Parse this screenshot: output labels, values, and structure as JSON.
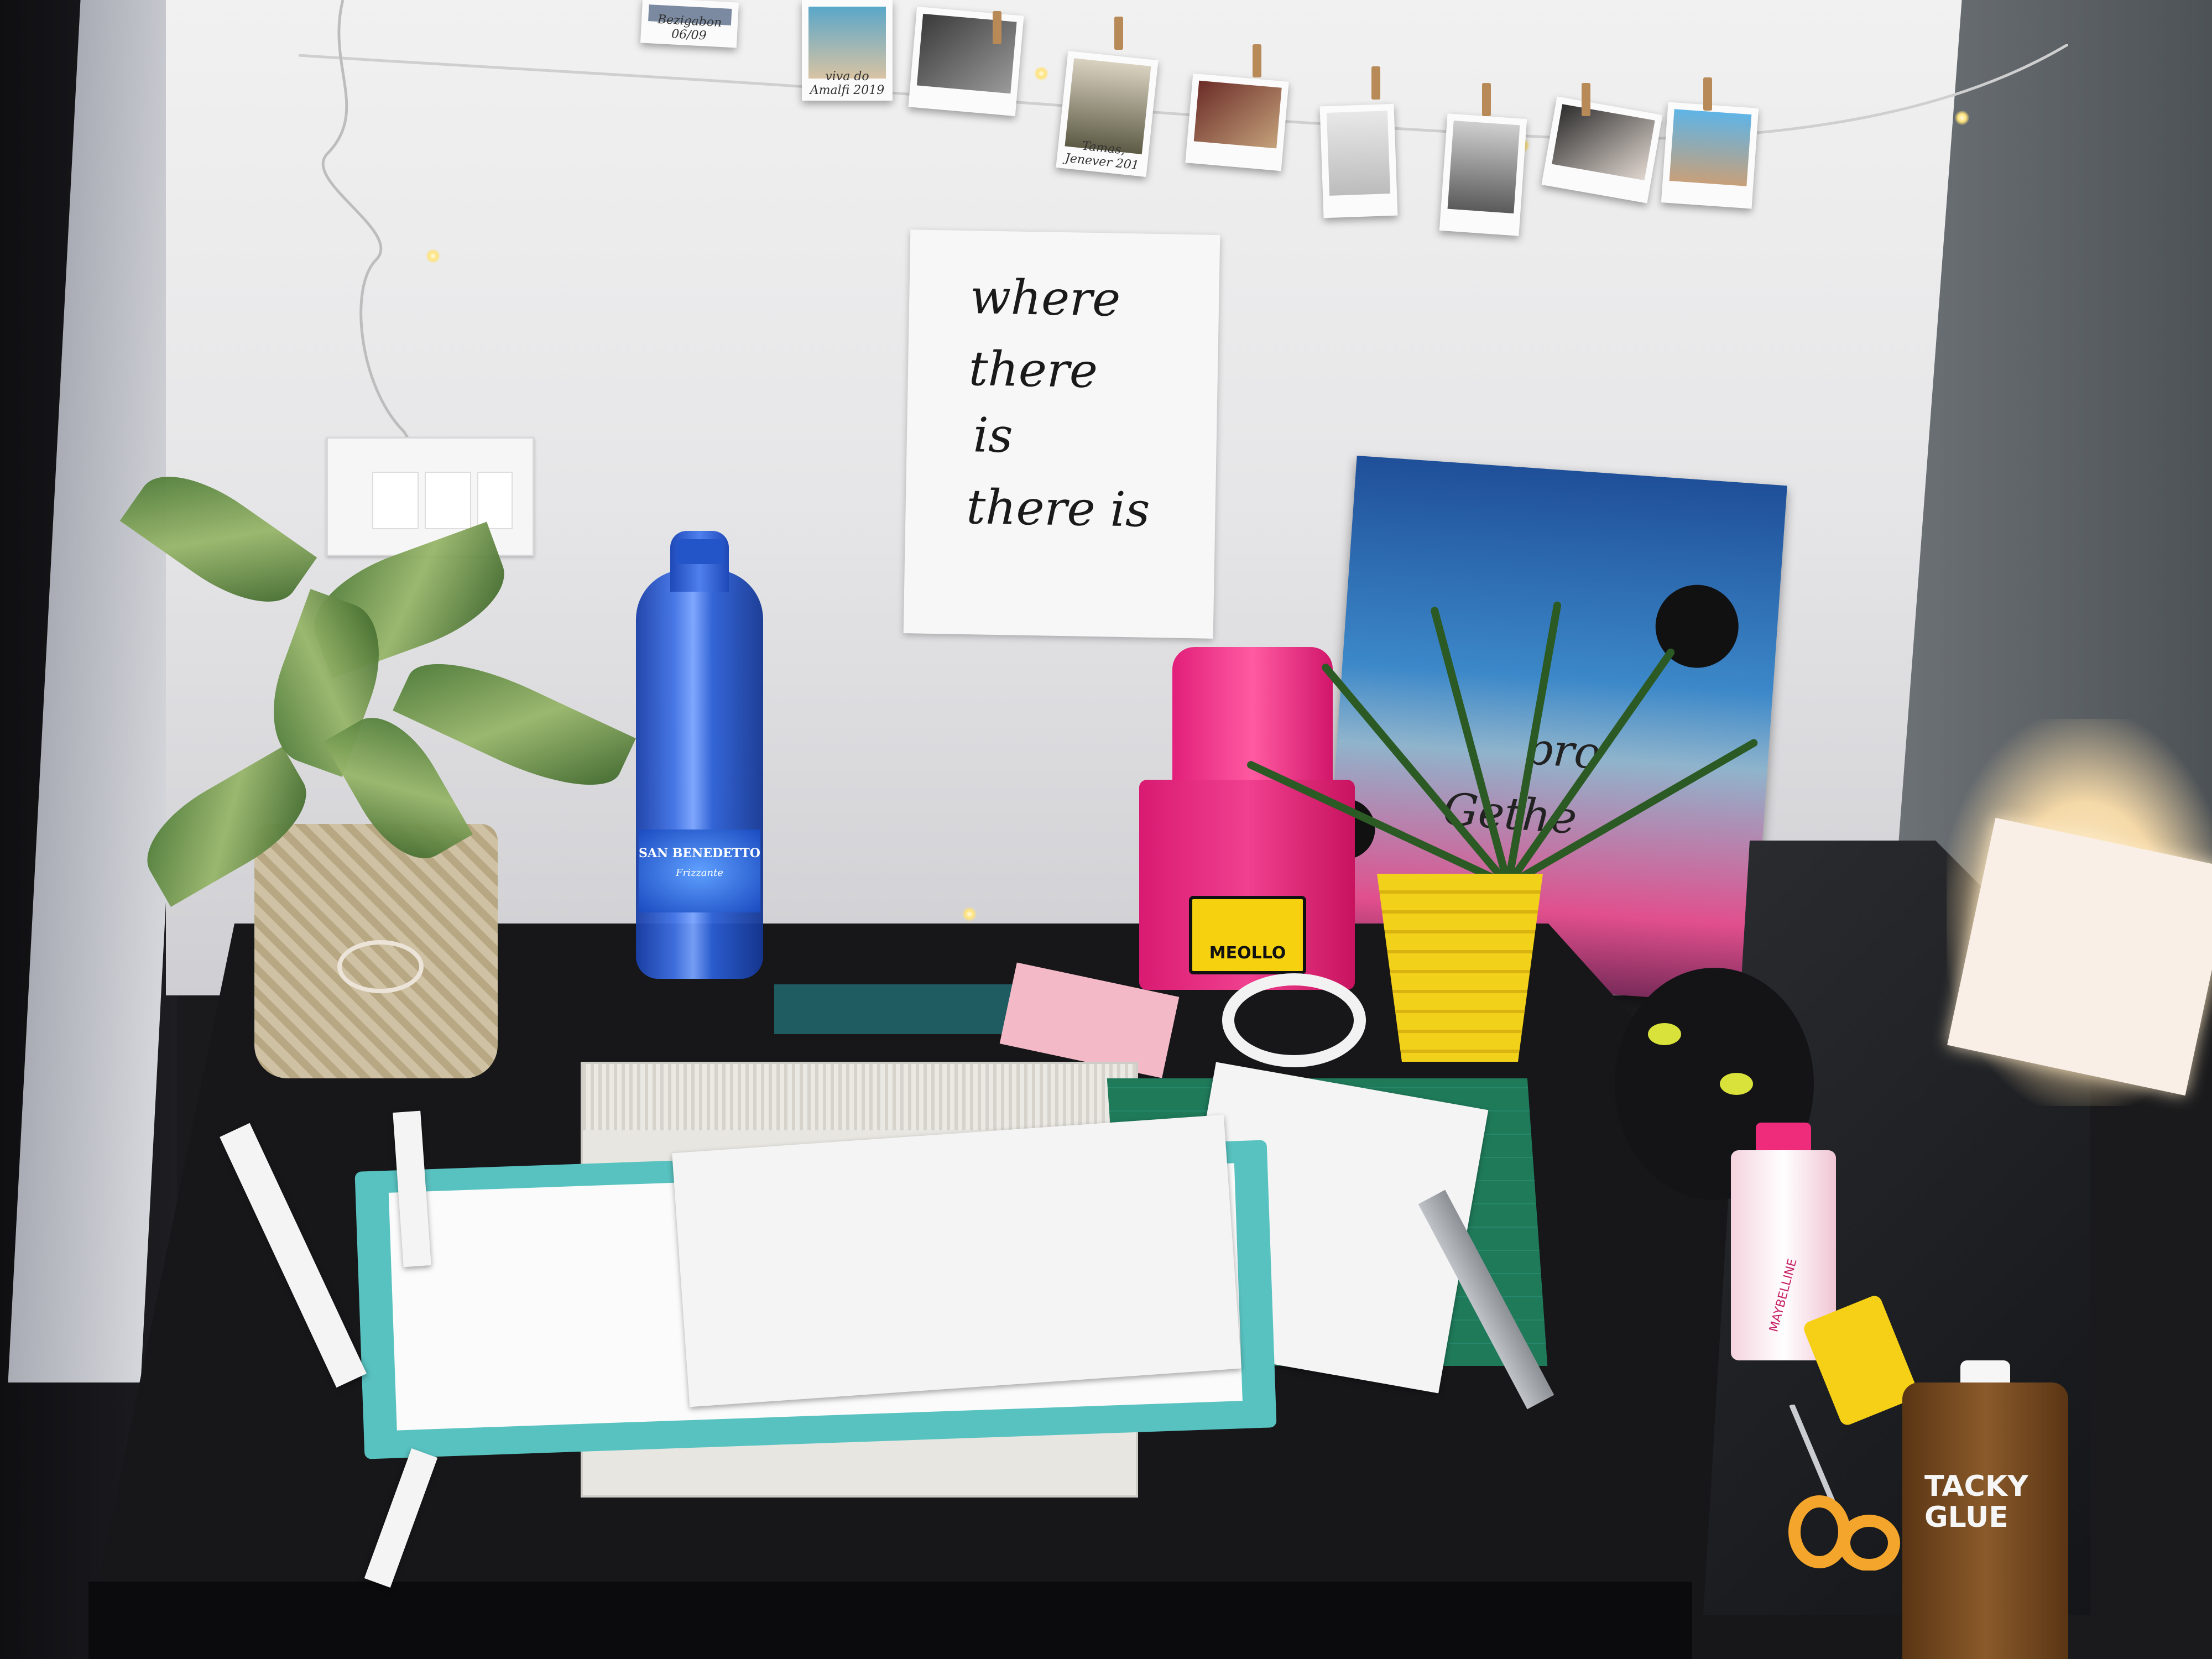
{
  "scene": {
    "description_type": "desk photo",
    "wall_poster": {
      "lines": [
        "where",
        "there",
        "is",
        "there is"
      ]
    },
    "polaroid_captions": [
      "Bezigabon 06/09",
      "viva do Amalfi 2019",
      "Tamas, Jenever 201"
    ],
    "bottle": {
      "brand": "SAN BENEDETTO",
      "variant": "Frizzante"
    },
    "bin_label": "MEOLLO",
    "painting_text": [
      "pro",
      "Gethe"
    ],
    "glue": {
      "brand_line1": "TACKY",
      "brand_line2": "GLUE"
    },
    "makeup_remover": "MAYBELLINE",
    "icons": [
      "string-lights",
      "potted-plant",
      "scissors"
    ]
  }
}
